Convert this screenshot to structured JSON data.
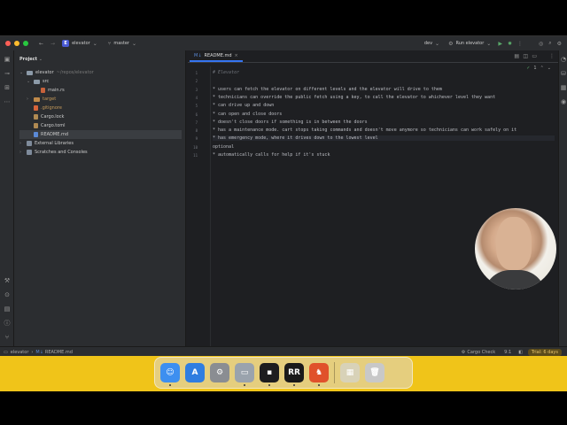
{
  "titlebar": {
    "project_badge": "E",
    "project_name": "elevator",
    "branch": "master",
    "run_config": "dev",
    "run_label": "Run elevator"
  },
  "project_panel": {
    "title": "Project",
    "tree": [
      {
        "label": "elevator",
        "suffix": "~/repos/elevator",
        "indent": 0,
        "kind": "folder",
        "open": true
      },
      {
        "label": "src",
        "indent": 1,
        "kind": "folder",
        "open": true
      },
      {
        "label": "main.rs",
        "indent": 2,
        "kind": "rust"
      },
      {
        "label": "target",
        "indent": 1,
        "kind": "folder-orange",
        "open": false
      },
      {
        "label": ".gitignore",
        "indent": 1,
        "kind": "git"
      },
      {
        "label": "Cargo.lock",
        "indent": 1,
        "kind": "cargo"
      },
      {
        "label": "Cargo.toml",
        "indent": 1,
        "kind": "cargo"
      },
      {
        "label": "README.md",
        "indent": 1,
        "kind": "md",
        "selected": true
      },
      {
        "label": "External Libraries",
        "indent": 0,
        "kind": "lib",
        "open": false
      },
      {
        "label": "Scratches and Consoles",
        "indent": 0,
        "kind": "scratch",
        "open": false
      }
    ]
  },
  "editor": {
    "tab_label": "README.md",
    "tab_prefix": "M↓",
    "problems": "1",
    "lines": [
      {
        "n": "1",
        "text": "# Elevator",
        "style": "h"
      },
      {
        "n": "2",
        "text": ""
      },
      {
        "n": "3",
        "text": "* users can fetch the elevator on different levels and the elevator will drive to them"
      },
      {
        "n": "4",
        "text": "* technicians can override the public fetch using a key, to call the elevator to whichever level they want"
      },
      {
        "n": "5",
        "text": "* can drive up and down"
      },
      {
        "n": "6",
        "text": "* can open and close doors"
      },
      {
        "n": "7",
        "text": "* doesn't close doors if something is in between the doors"
      },
      {
        "n": "8",
        "text": "* has a maintenance mode. cart stops taking commands and doesn't move anymore so technicians can work safely on it"
      },
      {
        "n": "9",
        "text": "* has emergency mode, where it drives down to the lowest level",
        "style": "hl"
      },
      {
        "n": "10",
        "text": "optional"
      },
      {
        "n": "11",
        "text": "* automatically calls for help if it's stuck"
      }
    ]
  },
  "statusbar": {
    "crumb_project": "elevator",
    "crumb_file": "README.md",
    "cargo_check": "Cargo Check",
    "position": "9:1",
    "trial": "Trial: 6 days"
  },
  "dock": {
    "apps": [
      {
        "name": "finder",
        "glyph": "☺",
        "color": "#3d8ff0",
        "running": true
      },
      {
        "name": "app-store",
        "glyph": "A",
        "color": "#2f7de0",
        "running": false
      },
      {
        "name": "system-settings",
        "glyph": "⚙",
        "color": "#8a8d92",
        "running": false
      },
      {
        "name": "screen-tool",
        "glyph": "▭",
        "color": "#9aa3ad",
        "running": true
      },
      {
        "name": "terminal-app",
        "glyph": "▪",
        "color": "#1d1d1f",
        "running": true
      },
      {
        "name": "rustrover",
        "glyph": "RR",
        "color": "#1a1a1a",
        "running": true
      },
      {
        "name": "brave",
        "glyph": "♞",
        "color": "#e0512b",
        "running": true
      }
    ],
    "extras": [
      {
        "name": "downloads-stack",
        "glyph": "▦",
        "color": "#d8d2b8"
      },
      {
        "name": "trash",
        "glyph": "🗑",
        "color": "#c8c8c8"
      }
    ]
  },
  "colors": {
    "accent": "#3574f0",
    "window_bg": "#1e1f22",
    "panel_bg": "#2b2d30",
    "desktop": "#f0c419"
  }
}
